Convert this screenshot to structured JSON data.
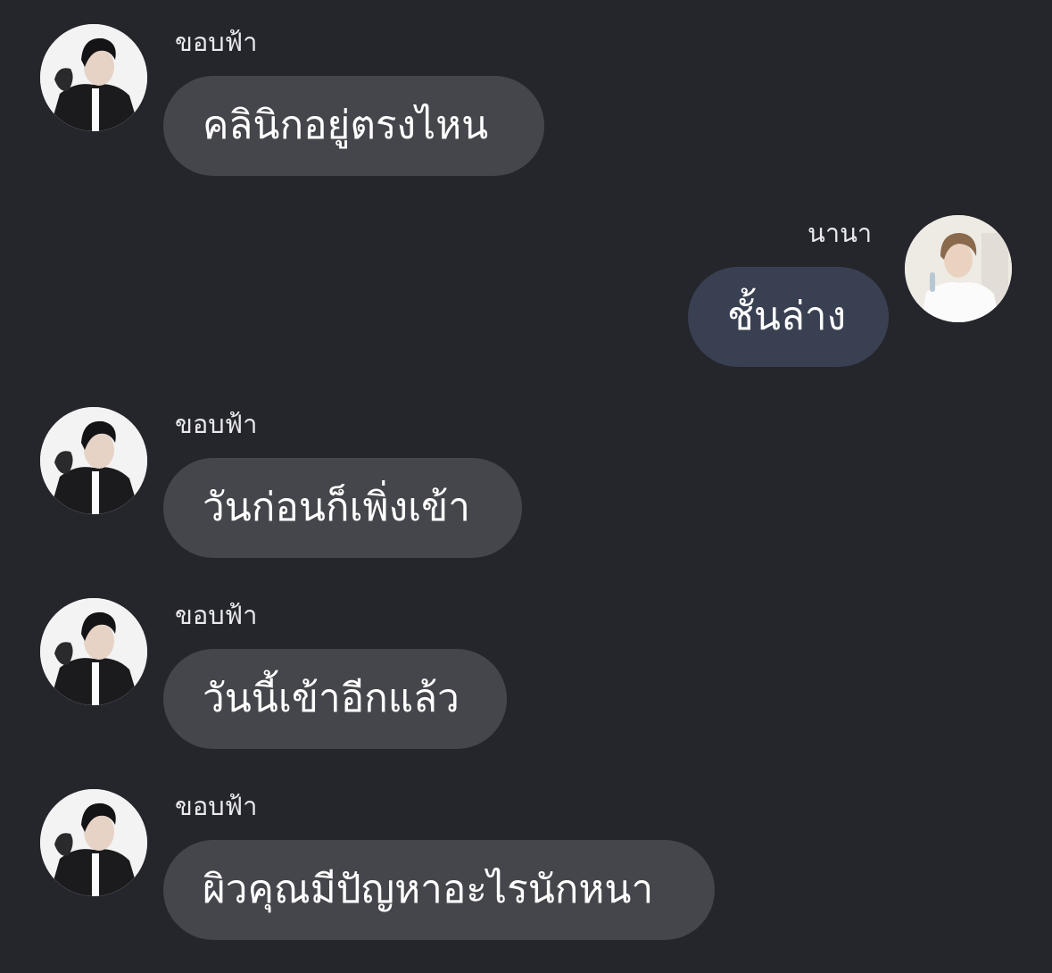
{
  "chat": {
    "messages": [
      {
        "direction": "incoming",
        "sender": "ขอบฟ้า",
        "text": "คลินิกอยู่ตรงไหน",
        "avatar_icon": "user-avatar-icon"
      },
      {
        "direction": "outgoing",
        "sender": "นานา",
        "text": "ชั้นล่าง",
        "avatar_icon": "user-avatar-icon"
      },
      {
        "direction": "incoming",
        "sender": "ขอบฟ้า",
        "text": "วันก่อนก็เพิ่งเข้า",
        "avatar_icon": "user-avatar-icon"
      },
      {
        "direction": "incoming",
        "sender": "ขอบฟ้า",
        "text": "วันนี้เข้าอีกแล้ว",
        "avatar_icon": "user-avatar-icon"
      },
      {
        "direction": "incoming",
        "sender": "ขอบฟ้า",
        "text": "ผิวคุณมีปัญหาอะไรนักหนา",
        "avatar_icon": "user-avatar-icon"
      }
    ]
  },
  "colors": {
    "background": "#25262c",
    "incoming_bubble": "#45464c",
    "outgoing_bubble": "#394052",
    "text": "#ffffff",
    "name_text": "#e9e9ee"
  }
}
